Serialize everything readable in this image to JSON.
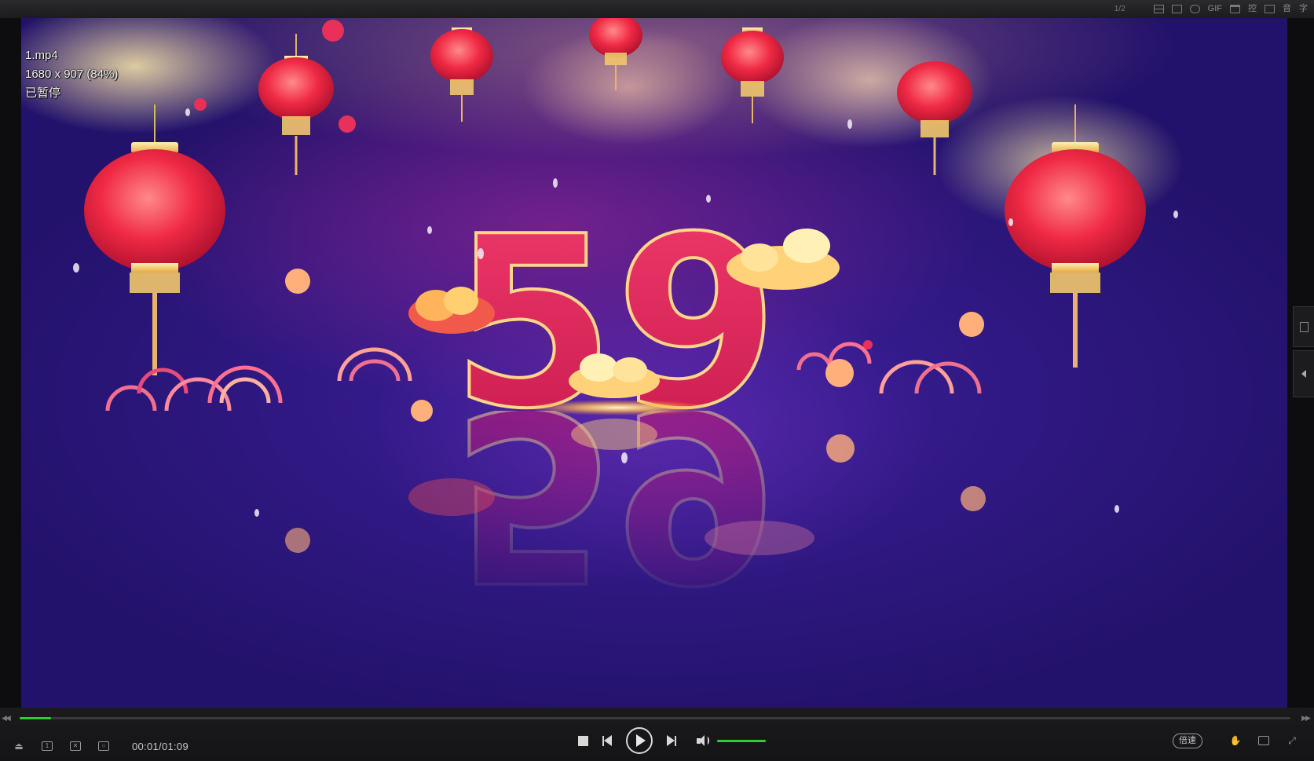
{
  "overlay": {
    "filename": "1.mp4",
    "resolution": "1680 x 907 (84%)",
    "status": "已暂停"
  },
  "video_frame": {
    "countdown_number": "59"
  },
  "top_toolbar": {
    "counter": "1/2",
    "icons": [
      "pin-icon",
      "frame-icon",
      "crop-icon",
      "gif-icon",
      "window-icon",
      "control-icon",
      "grid-icon",
      "audio-icon",
      "subtitle-icon"
    ],
    "gif_label": "GIF",
    "control_label": "控",
    "audio_label": "音",
    "subtitle_label": "字"
  },
  "playback": {
    "time": "00:01/01:09",
    "progress_fraction": 0.025,
    "volume_fraction": 1.0,
    "speed_label": "倍速",
    "accent": "#2bd12b"
  }
}
